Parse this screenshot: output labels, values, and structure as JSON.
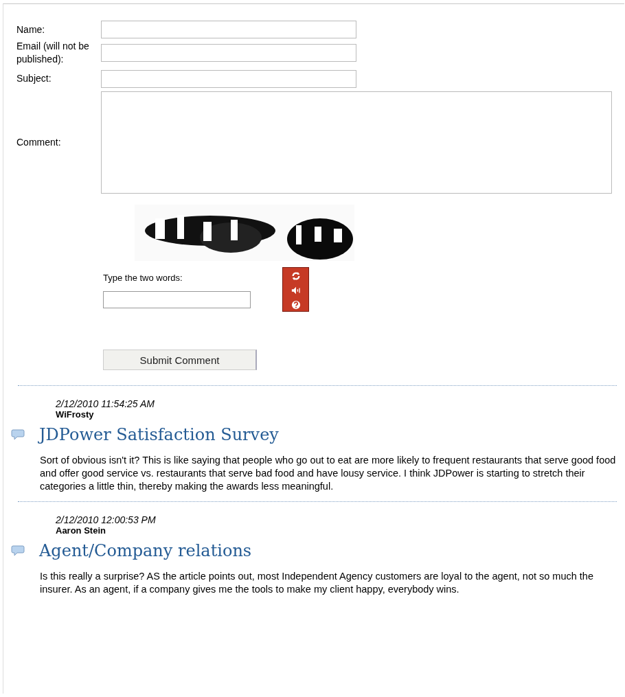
{
  "form": {
    "fields": [
      {
        "label": "Name:",
        "kind": "text"
      },
      {
        "label": "Email (will not be published):",
        "kind": "text"
      },
      {
        "label": "Subject:",
        "kind": "text"
      },
      {
        "label": "Comment:",
        "kind": "textarea"
      }
    ],
    "captcha": {
      "kind": "picture",
      "prompt": "Type the two words:"
    },
    "submit": "Submit Comment"
  },
  "comments": [
    {
      "date": "2/12/2010 11:54:25 AM",
      "author": "WiFrosty",
      "title": "JDPower Satisfaction Survey",
      "body": "Sort of obvious isn't it? This is like saying that people who go out to eat are more likely to frequent restaurants that serve good food and offer good service vs. restaurants that serve bad food and have lousy service. I think JDPower is starting to stretch their categories a little thin, thereby making the awards less meaningful."
    },
    {
      "date": "2/12/2010 12:00:53 PM",
      "author": "Aaron Stein",
      "title": "Agent/Company relations",
      "body": "Is this really a surprise? AS the article points out, most Independent Agency customers are loyal to the agent, not so much the insurer. As an agent, if a company gives me the tools to make my client happy, everybody wins."
    }
  ]
}
